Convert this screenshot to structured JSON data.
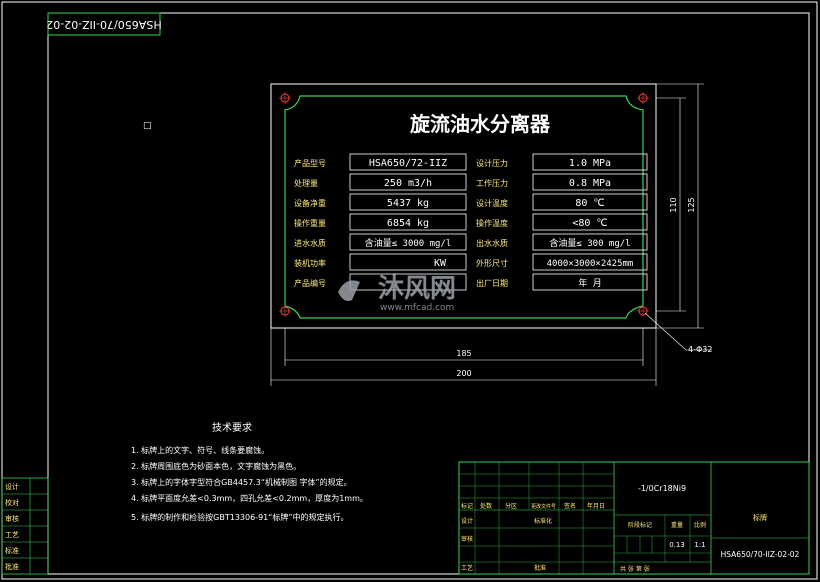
{
  "drawing_code_rotated": "HSA650/70-IIZ-02-02",
  "small_mark": "□",
  "plate": {
    "title": "旋流油水分离器",
    "rows": [
      {
        "l1": "产品型号",
        "v1": "HSA650/72-IIZ",
        "l2": "设计压力",
        "v2": "1.0 MPa"
      },
      {
        "l1": "处理量",
        "v1": "250     m3/h",
        "l2": "工作压力",
        "v2": "0.8 MPa"
      },
      {
        "l1": "设备净重",
        "v1": "5437     kg",
        "l2": "设计温度",
        "v2": "80 ℃"
      },
      {
        "l1": "操作重量",
        "v1": "6854     kg",
        "l2": "操作温度",
        "v2": "<80 ℃"
      },
      {
        "l1": "进水水质",
        "v1": "含油量≤ 3000   mg/l",
        "l2": "出水水质",
        "v2": "含油量≤ 300  mg/l"
      },
      {
        "l1": "装机功率",
        "v1": "KW",
        "l2": "外形尺寸",
        "v2": "4000×3000×2425mm"
      },
      {
        "l1": "产品编号",
        "v1": "",
        "l2": "出厂日期",
        "v2": "年       月"
      }
    ]
  },
  "dims": {
    "d110": "110",
    "d125": "125",
    "d185": "185",
    "d200": "200",
    "holes": "4-Φ32"
  },
  "tech": {
    "heading": "技术要求",
    "items": [
      "1.  标牌上的文字、符号、线条要腐蚀。",
      "2.  标牌周围底色为砂面本色，文字腐蚀为黑色。",
      "3.  标牌上的字体字型符合GB4457.3“机械制图 字体”的规定。",
      "4.  标牌平面度允差<0.3mm，四孔允差<0.2mm，厚度为1mm。",
      "5.  标牌的制作和检验按GBT13306-91“标牌”中的规定执行。"
    ]
  },
  "left_block": [
    "设计",
    "校对",
    "审核",
    "工艺",
    "标准",
    "批准"
  ],
  "title_block": {
    "material": "-1/0Cr18Ni9",
    "headers": [
      "标记",
      "处数",
      "分区",
      "更改文件号",
      "签名",
      "年月日"
    ],
    "rows_left": [
      "设计",
      "审核",
      "工艺"
    ],
    "std_label": "标准化",
    "approve_label": "批准",
    "stage_label": "阶段标记",
    "weight_label": "重量",
    "scale_label": "比例",
    "weight": "0.13",
    "scale": "1:1",
    "sheets": "共     张          第     张",
    "name": "标牌",
    "code": "HSA650/70-IIZ-02-02"
  },
  "watermark": {
    "main": "沐风网",
    "url": "www.mfcad.com"
  }
}
